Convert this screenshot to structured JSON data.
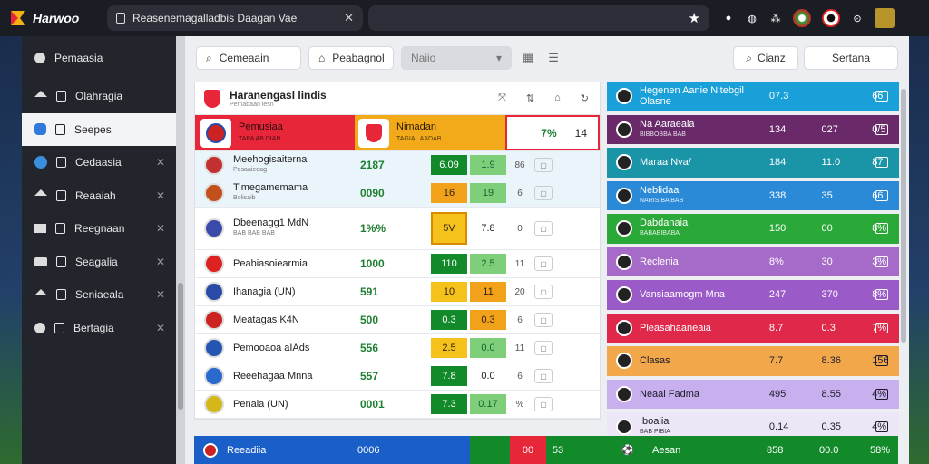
{
  "browser": {
    "brand": "Harwoo",
    "tab_title": "Reasenemagalladbis Daagan Vae",
    "icons": [
      "star-icon",
      "profile-icon",
      "shield-icon",
      "extensions-icon"
    ]
  },
  "sidebar": {
    "header": "Pemaasia",
    "items": [
      {
        "label": "Olahragia",
        "icon": "home-icon",
        "active": false,
        "closable": false
      },
      {
        "label": "Seepes",
        "icon": "shield-icon",
        "active": true,
        "closable": false
      },
      {
        "label": "Cedaasia",
        "icon": "globe-icon",
        "active": false,
        "closable": true
      },
      {
        "label": "Reaaiah",
        "icon": "home-icon",
        "active": false,
        "closable": true
      },
      {
        "label": "Reegnaan",
        "icon": "mail-icon",
        "active": false,
        "closable": true
      },
      {
        "label": "Seagalia",
        "icon": "bag-icon",
        "active": false,
        "closable": true
      },
      {
        "label": "Seniaeala",
        "icon": "home-icon",
        "active": false,
        "closable": true
      },
      {
        "label": "Bertagia",
        "icon": "circle-icon",
        "active": false,
        "closable": true
      }
    ]
  },
  "toolbar": {
    "search_label": "Cemeaain",
    "filter_label": "Peabagnol",
    "select_value": "Naiio",
    "right1_label": "Cianz",
    "right2_label": "Sertana"
  },
  "left_table": {
    "title": "Haranengasl lindis",
    "subtitle": "Pemabaan lesn",
    "featured": {
      "a_name": "Pemusiaa",
      "a_sub": "TAPA AB DIAN",
      "b_name": "Nimadan",
      "b_sub": "TAGIAL AADAB",
      "pct": "7%",
      "num": "14"
    },
    "rows": [
      {
        "name": "Meehogisaiterna",
        "sub": "Pesaaiedag",
        "score": "2187",
        "c1": "6.09",
        "c2": "1.9",
        "m": "86",
        "badge": "#c23030"
      },
      {
        "name": "Timegamemama",
        "sub": "Bolisaib",
        "score": "0090",
        "c1": "16",
        "c2": "19",
        "m": "6",
        "badge": "#c2501a"
      },
      {
        "name": "Dbeenagg1 MdN",
        "sub": "BAB BAB BAB",
        "score": "1%%",
        "c1": "5V",
        "c2": "7.8",
        "m": "0",
        "badge": "#3a4aa8"
      },
      {
        "name": "Peabiasoiearmia",
        "sub": "",
        "score": "1000",
        "c1": "110",
        "c2": "2.5",
        "m": "11",
        "badge": "#d22"
      },
      {
        "name": "Ihanagia (UN)",
        "sub": "",
        "score": "591",
        "c1": "10",
        "c2": "11",
        "m": "20",
        "badge": "#2a4aa8"
      },
      {
        "name": "Meatagas K4N",
        "sub": "",
        "score": "500",
        "c1": "0.3",
        "c2": "0.3",
        "m": "6",
        "badge": "#c22"
      },
      {
        "name": "Pemooaoa aIAds",
        "sub": "",
        "score": "556",
        "c1": "2.5",
        "c2": "0.0",
        "m": "11",
        "badge": "#2455b0"
      },
      {
        "name": "Reeehagaa Mnna",
        "sub": "",
        "score": "557",
        "c1": "7.8",
        "c2": "0.0",
        "m": "6",
        "badge": "#2a6acc"
      },
      {
        "name": "Penaia (UN)",
        "sub": "",
        "score": "0001",
        "c1": "7.3",
        "c2": "0.17",
        "m": "%",
        "badge": "#d4b81a"
      }
    ]
  },
  "right_panel": {
    "rows": [
      {
        "name": "Hegenen Aanie Nitebgil Olasne",
        "sub": "",
        "v1": "07.3",
        "v2": "",
        "v3": "66",
        "color": "#1aa0d8"
      },
      {
        "name": "Na Aaraeaia",
        "sub": "BIBBOBBA BAB",
        "v1": "134",
        "v2": "027",
        "v3": "0/5",
        "color": "#6a2a6a"
      },
      {
        "name": "Maraa Nva/",
        "sub": "",
        "v1": "184",
        "v2": "11.0",
        "v3": "87",
        "color": "#1a95a8"
      },
      {
        "name": "Neblidaa",
        "sub": "NARISIBA BAB",
        "v1": "338",
        "v2": "35",
        "v3": "66",
        "color": "#2a8ad8"
      },
      {
        "name": "Dabdanaia",
        "sub": "BABABIBABA",
        "v1": "150",
        "v2": "00",
        "v3": "8%",
        "color": "#2aa838"
      },
      {
        "name": "Reclenia",
        "sub": "",
        "v1": "8%",
        "v2": "30",
        "v3": "3%",
        "color": "#a66ac8"
      },
      {
        "name": "Vansiaamogm Mna",
        "sub": "",
        "v1": "247",
        "v2": "370",
        "v3": "8%",
        "color": "#9a5ac8"
      },
      {
        "name": "Pleasahaaneaia",
        "sub": "",
        "v1": "8.7",
        "v2": "0.3",
        "v3": "7%",
        "color": "#e0284a"
      },
      {
        "name": "Clasas",
        "sub": "",
        "v1": "7.7",
        "v2": "8.36",
        "v3": "156",
        "color": "#f2a84a"
      },
      {
        "name": "Neaai Fadma",
        "sub": "",
        "v1": "495",
        "v2": "8.55",
        "v3": "4%",
        "color": "#c8b0ee"
      },
      {
        "name": "Iboalia",
        "sub": "BAB PIBIA",
        "v1": "0.14",
        "v2": "0.35",
        "v3": "4%",
        "color": "#ece6f6"
      }
    ]
  },
  "bottom_strip": {
    "name": "Reeadiia",
    "score": "0006",
    "c1": "00",
    "c2": "53",
    "r_name": "Aesan",
    "r_v1": "858",
    "r_v2": "00.0",
    "r_v3": "58%"
  }
}
